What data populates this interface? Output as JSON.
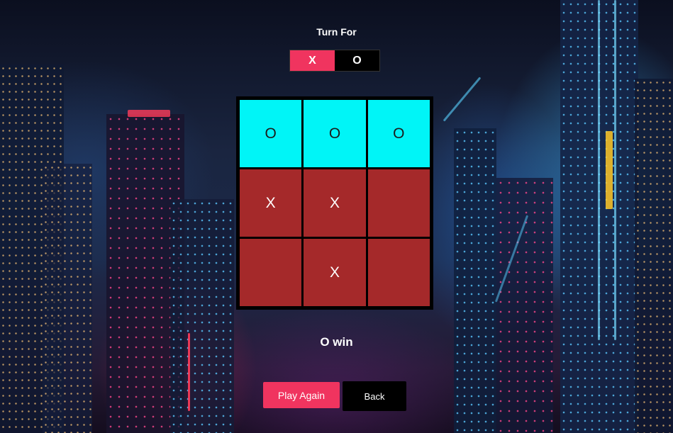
{
  "turn": {
    "title": "Turn For",
    "players": [
      {
        "symbol": "X",
        "active": true
      },
      {
        "symbol": "O",
        "active": false
      }
    ]
  },
  "board": {
    "cells": [
      "O",
      "O",
      "O",
      "X",
      "X",
      "",
      "",
      "X",
      ""
    ],
    "winning_line": [
      0,
      1,
      2
    ]
  },
  "result": "O win",
  "buttons": {
    "play_again": "Play Again",
    "back": "Back"
  },
  "colors": {
    "accent": "#f0345f",
    "win_cell": "#00f5f7",
    "cell": "#a5292a",
    "board_border": "#000000"
  }
}
